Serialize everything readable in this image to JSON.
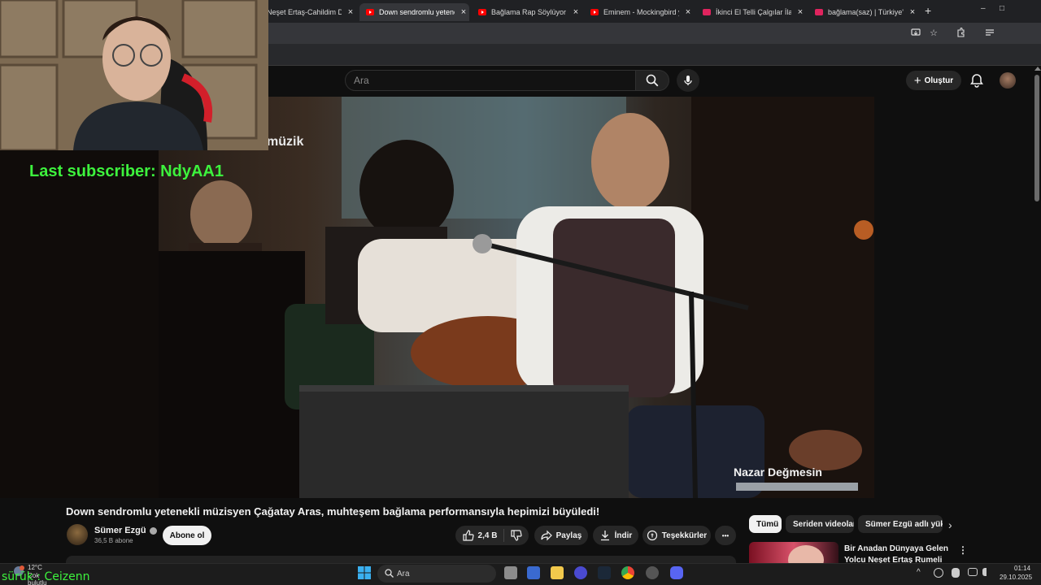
{
  "browser": {
    "tabs": [
      {
        "title": "Neşet Ertaş-Cahildim Dün",
        "active": false
      },
      {
        "title": "Down sendromlu yetenek",
        "active": true
      },
      {
        "title": "Bağlama Rap Söylüyor :) (",
        "active": false
      },
      {
        "title": "Eminem - Mockingbird y",
        "active": false
      },
      {
        "title": "İkinci El Telli Çalgılar İlanl",
        "active": false
      },
      {
        "title": "bağlama(saz) | Türkiye'de",
        "active": false
      }
    ],
    "new_tab": "+",
    "minimize": "–",
    "maximize": "□",
    "close": "×"
  },
  "youtube": {
    "search_placeholder": "Ara",
    "create_label": "Oluştur"
  },
  "stream_overlay": {
    "last_subscriber": "Last subscriber: NdyAA1",
    "chat_name": "sürük : Ceizenn"
  },
  "video": {
    "watermark": "müzik",
    "caption": "Nazar Değmesin",
    "title": "Down sendromlu yetenekli müzisyen Çağatay Aras, muhteşem bağlama performansıyla hepimizi büyüledi!",
    "channel": {
      "name": "Sümer Ezgü",
      "subscribers": "36,5 B abone",
      "subscribe_label": "Abone ol"
    },
    "actions": {
      "likes": "2,4 B",
      "share": "Paylaş",
      "download": "İndir",
      "thanks": "Teşekkürler",
      "more": "•••"
    }
  },
  "sidebar": {
    "chips": [
      "Tümü",
      "Seriden videolar",
      "Sümer Ezgü adlı yükle"
    ],
    "recommended": {
      "title": "Bir Anadan Dünyaya Gelen Yolcu Neşet Ertaş Rumeli Hisa"
    }
  },
  "taskbar": {
    "search_placeholder": "Ara",
    "temperature": "12°C",
    "weather_text": "Çok bulutlu",
    "time": "01:14",
    "date": "29.10.2025"
  },
  "colors": {
    "youtube_red": "#ff0000",
    "overlay_green": "#3df23d",
    "background": "#0f0f0f"
  }
}
